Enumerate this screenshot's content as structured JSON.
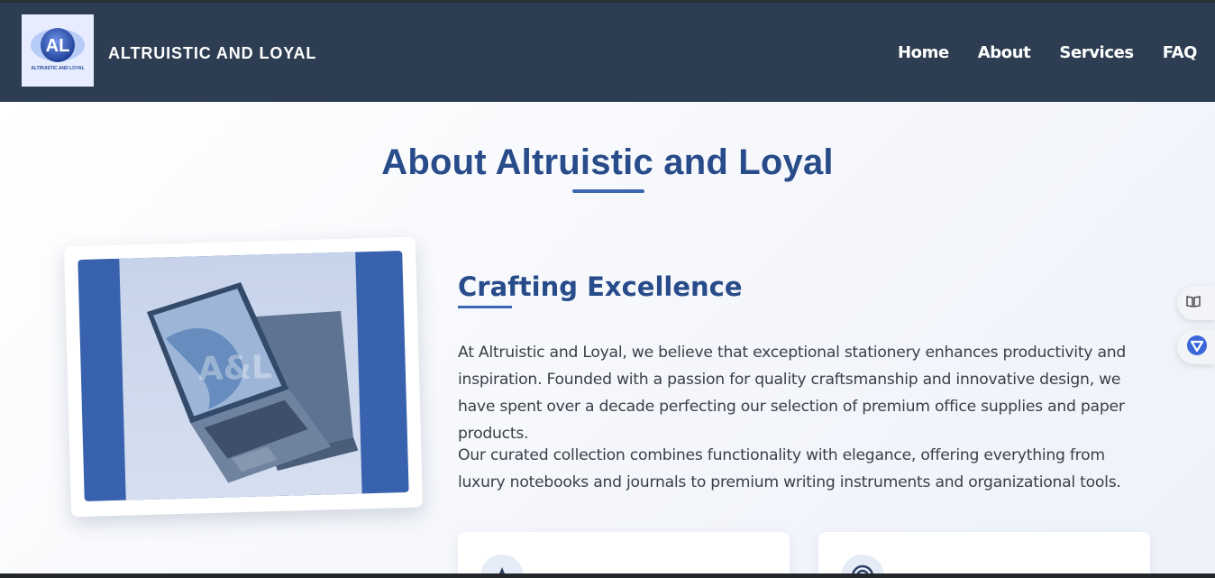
{
  "header": {
    "logo_monogram": "AL",
    "logo_tagline": "ALTRUISTIC AND LOYAL",
    "brand": "ALTRUISTIC AND LOYAL",
    "nav": [
      {
        "label": "Home"
      },
      {
        "label": "About"
      },
      {
        "label": "Services"
      },
      {
        "label": "FAQ"
      }
    ]
  },
  "about": {
    "title": "About Altruistic and Loyal",
    "image_watermark": "A&L",
    "subheading": "Crafting Excellence",
    "paragraphs": [
      "At Altruistic and Loyal, we believe that exceptional stationery enhances productivity and inspiration. Founded with a passion for quality craftsmanship and innovative design, we have spent over a decade perfecting our selection of premium office supplies and paper products.",
      "Our curated collection combines functionality with elegance, offering everything from luxury notebooks and journals to premium writing instruments and organizational tools."
    ],
    "cards": [
      {
        "icon": "star-icon"
      },
      {
        "icon": "target-icon"
      }
    ]
  },
  "side_toolbar": [
    {
      "icon": "book-icon"
    },
    {
      "icon": "extension-v-icon"
    }
  ],
  "colors": {
    "nav_bg": "#2e3e52",
    "accent": "#284b8a",
    "accent_light": "#3d66b3"
  }
}
